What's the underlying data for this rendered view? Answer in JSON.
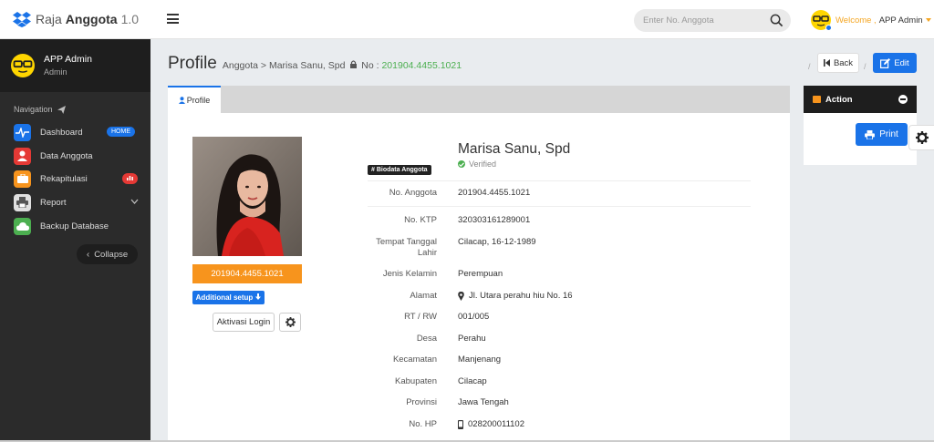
{
  "brand": {
    "part1": "Raja",
    "part2": "Anggota",
    "version": "1.0"
  },
  "search": {
    "placeholder": "Enter No. Anggota"
  },
  "user_menu": {
    "welcome": "Welcome ,",
    "name": "APP Admin"
  },
  "sidebar": {
    "user_name": "APP Admin",
    "user_role": "Admin",
    "nav_title": "Navigation",
    "items": [
      {
        "label": "Dashboard",
        "badge": "HOME",
        "icon": "heartbeat-icon",
        "color": "#1a73e8"
      },
      {
        "label": "Data Anggota",
        "icon": "user-icon",
        "color": "#e53935"
      },
      {
        "label": "Rekapitulasi",
        "badge_icon": "chart-badge",
        "icon": "briefcase-icon",
        "color": "#f7941d"
      },
      {
        "label": "Report",
        "icon": "printer-icon",
        "color": "#e0e0e0"
      },
      {
        "label": "Backup Database",
        "icon": "cloud-icon",
        "color": "#4caf50"
      }
    ],
    "collapse_label": "Collapse"
  },
  "page": {
    "title": "Profile",
    "breadcrumb_parent": "Anggota",
    "breadcrumb_sep": ">",
    "breadcrumb_name": "Marisa Sanu, Spd",
    "breadcrumb_no_label": "No :",
    "breadcrumb_no_value": "201904.4455.1021",
    "back_label": "Back",
    "edit_label": "Edit"
  },
  "tab": {
    "label": "Profile"
  },
  "profile": {
    "member_no_bar": "201904.4455.1021",
    "additional_setup": "Additional setup",
    "aktivasi_login": "Aktivasi Login",
    "name": "Marisa Sanu, Spd",
    "verified": "Verified",
    "bio_badge": "# Biodata Anggota",
    "fields": [
      {
        "label": "No. Anggota",
        "value": "201904.4455.1021"
      },
      {
        "label": "No. KTP",
        "value": "320303161289001"
      },
      {
        "label": "Tempat Tanggal",
        "label2": "Lahir",
        "value": "Cilacap, 16-12-1989"
      },
      {
        "label": "Jenis Kelamin",
        "value": "Perempuan"
      },
      {
        "label": "Alamat",
        "value": "Jl. Utara perahu hiu No. 16",
        "icon": "map-marker-icon"
      },
      {
        "label": "RT / RW",
        "value": "001/005"
      },
      {
        "label": "Desa",
        "value": "Perahu"
      },
      {
        "label": "Kecamatan",
        "value": "Manjenang"
      },
      {
        "label": "Kabupaten",
        "value": "Cilacap"
      },
      {
        "label": "Provinsi",
        "value": "Jawa Tengah"
      },
      {
        "label": "No. HP",
        "value": "028200011102",
        "icon": "mobile-icon"
      }
    ]
  },
  "action": {
    "title": "Action",
    "print_label": "Print"
  },
  "colors": {
    "accent": "#1a73e8",
    "orange": "#f7941d",
    "green": "#4caf50",
    "sidebar": "#2b2b2b"
  }
}
